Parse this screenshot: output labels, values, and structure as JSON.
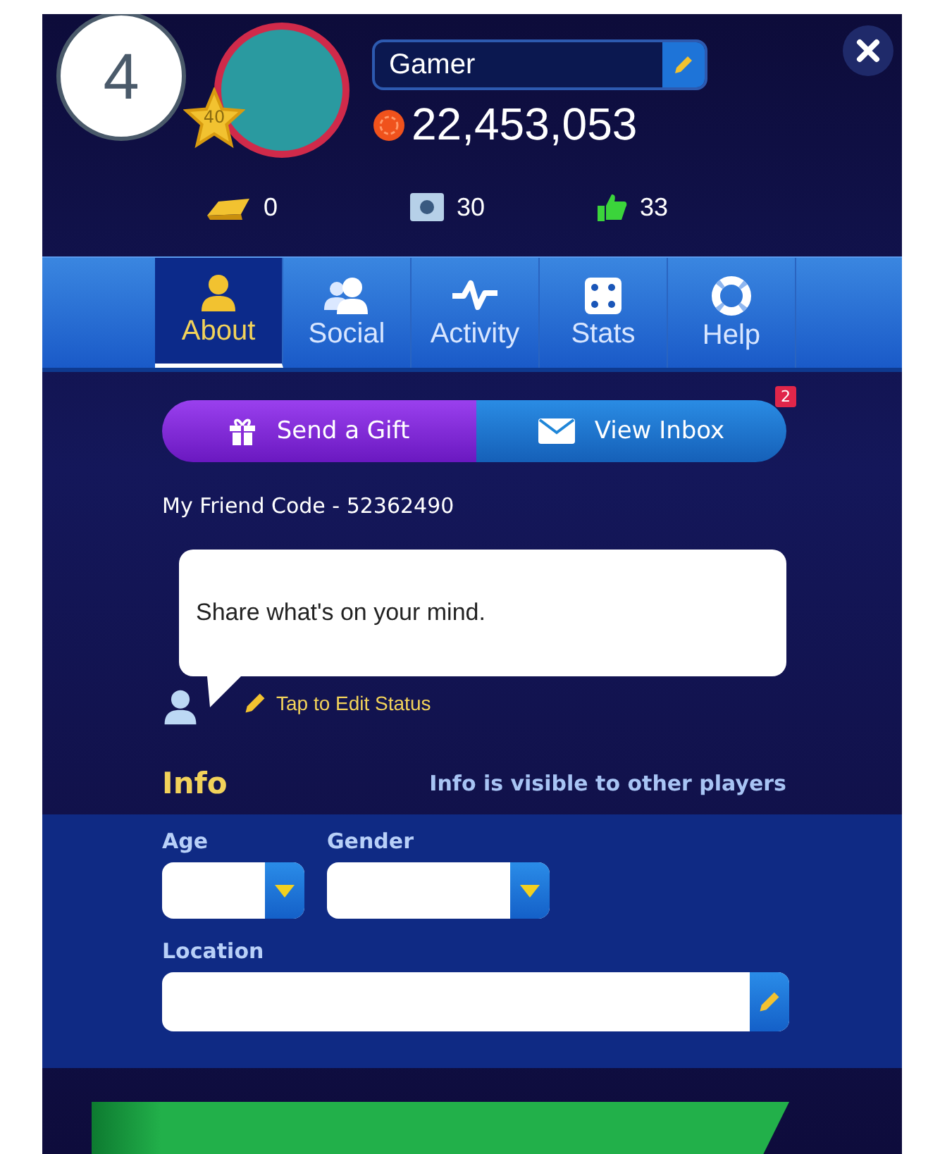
{
  "step_badge": "4",
  "profile": {
    "level": "40",
    "name": "Gamer",
    "chips": "22,453,053"
  },
  "stats": [
    {
      "kind": "gold",
      "value": "0"
    },
    {
      "kind": "ticket",
      "value": "30"
    },
    {
      "kind": "likes",
      "value": "33"
    }
  ],
  "tabs": [
    {
      "kind": "about",
      "label": "About",
      "selected": true
    },
    {
      "kind": "social",
      "label": "Social",
      "selected": false
    },
    {
      "kind": "activity",
      "label": "Activity",
      "selected": false
    },
    {
      "kind": "stats",
      "label": "Stats",
      "selected": false
    },
    {
      "kind": "help",
      "label": "Help",
      "selected": false
    }
  ],
  "actions": [
    {
      "kind": "gift",
      "label": "Send a Gift"
    },
    {
      "kind": "inbox",
      "label": "View Inbox",
      "badge": "2"
    }
  ],
  "friend_code": "My Friend Code - 52362490",
  "status": {
    "text": "Share what's on your mind.",
    "edit_label": "Tap to Edit Status"
  },
  "info": {
    "title": "Info",
    "note": "Info is visible to other players",
    "fields": [
      {
        "kind": "dropdown",
        "label": "Age"
      },
      {
        "kind": "dropdown",
        "label": "Gender"
      },
      {
        "kind": "text",
        "label": "Location"
      }
    ]
  }
}
